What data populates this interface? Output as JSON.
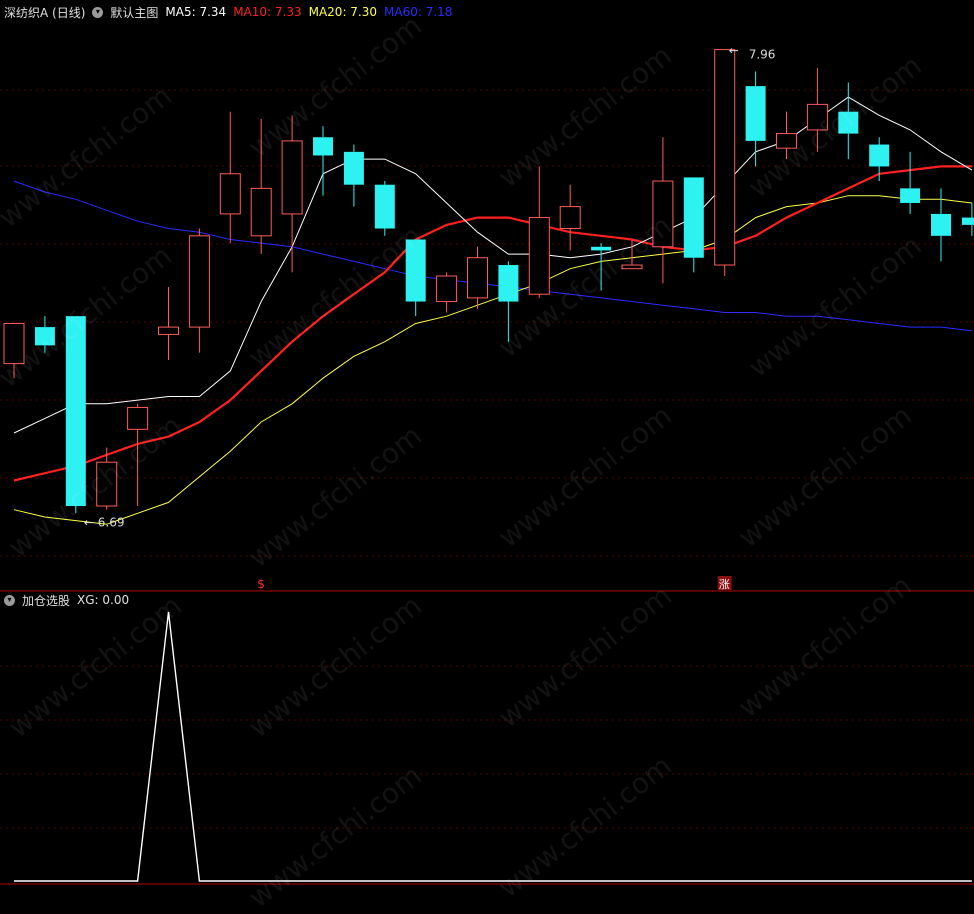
{
  "main_header": {
    "stock_title": "深纺织A (日线)",
    "template_name": "默认主图",
    "ma5": "MA5: 7.34",
    "ma10": "MA10: 7.33",
    "ma20": "MA20: 7.30",
    "ma60": "MA60: 7.18"
  },
  "sub_header": {
    "indicator_name": "加仓选股",
    "xg": "XG: 0.00"
  },
  "watermark": "www.cfchi.com",
  "colors": {
    "background": "#000000",
    "up": "#ff5b5b",
    "down": "#2ef2f2",
    "ma5": "#ffffff",
    "ma10": "#ff2020",
    "ma20": "#ffff4a",
    "ma60": "#2b2bff",
    "grid": "#5a0000",
    "divider": "#b00000"
  },
  "chart_data": [
    {
      "type": "candlestick",
      "title": "深纺织A (日线)",
      "ylim": [
        6.48,
        8.02
      ],
      "grid": true,
      "high_label": "7.96",
      "low_label": "6.69",
      "markers": [
        "$",
        "涨"
      ],
      "candles": [
        {
          "o": 7.1,
          "c": 7.21,
          "h": 7.21,
          "l": 7.06
        },
        {
          "o": 7.2,
          "c": 7.15,
          "h": 7.23,
          "l": 7.13
        },
        {
          "o": 7.23,
          "c": 6.71,
          "h": 7.23,
          "l": 6.69
        },
        {
          "o": 6.71,
          "c": 6.83,
          "h": 6.87,
          "l": 6.7
        },
        {
          "o": 6.92,
          "c": 6.98,
          "h": 6.99,
          "l": 6.71
        },
        {
          "o": 7.18,
          "c": 7.2,
          "h": 7.31,
          "l": 7.11
        },
        {
          "o": 7.2,
          "c": 7.45,
          "h": 7.47,
          "l": 7.13
        },
        {
          "o": 7.51,
          "c": 7.62,
          "h": 7.79,
          "l": 7.43
        },
        {
          "o": 7.45,
          "c": 7.58,
          "h": 7.77,
          "l": 7.4
        },
        {
          "o": 7.51,
          "c": 7.71,
          "h": 7.78,
          "l": 7.35
        },
        {
          "o": 7.72,
          "c": 7.67,
          "h": 7.75,
          "l": 7.56
        },
        {
          "o": 7.68,
          "c": 7.59,
          "h": 7.7,
          "l": 7.53
        },
        {
          "o": 7.59,
          "c": 7.47,
          "h": 7.6,
          "l": 7.45
        },
        {
          "o": 7.44,
          "c": 7.27,
          "h": 7.44,
          "l": 7.23
        },
        {
          "o": 7.27,
          "c": 7.34,
          "h": 7.35,
          "l": 7.24
        },
        {
          "o": 7.28,
          "c": 7.39,
          "h": 7.42,
          "l": 7.25
        },
        {
          "o": 7.37,
          "c": 7.27,
          "h": 7.38,
          "l": 7.16
        },
        {
          "o": 7.29,
          "c": 7.5,
          "h": 7.64,
          "l": 7.28
        },
        {
          "o": 7.47,
          "c": 7.53,
          "h": 7.59,
          "l": 7.41
        },
        {
          "o": 7.42,
          "c": 7.41,
          "h": 7.43,
          "l": 7.3
        },
        {
          "o": 7.36,
          "c": 7.37,
          "h": 7.44,
          "l": 7.36
        },
        {
          "o": 7.42,
          "c": 7.6,
          "h": 7.72,
          "l": 7.32
        },
        {
          "o": 7.61,
          "c": 7.39,
          "h": 7.61,
          "l": 7.35
        },
        {
          "o": 7.37,
          "c": 7.96,
          "h": 7.96,
          "l": 7.34
        },
        {
          "o": 7.86,
          "c": 7.71,
          "h": 7.9,
          "l": 7.64
        },
        {
          "o": 7.69,
          "c": 7.73,
          "h": 7.79,
          "l": 7.66
        },
        {
          "o": 7.74,
          "c": 7.81,
          "h": 7.91,
          "l": 7.68
        },
        {
          "o": 7.79,
          "c": 7.73,
          "h": 7.87,
          "l": 7.66
        },
        {
          "o": 7.7,
          "c": 7.64,
          "h": 7.72,
          "l": 7.6
        },
        {
          "o": 7.58,
          "c": 7.54,
          "h": 7.68,
          "l": 7.51
        },
        {
          "o": 7.51,
          "c": 7.45,
          "h": 7.58,
          "l": 7.38
        },
        {
          "o": 7.5,
          "c": 7.48,
          "h": 7.54,
          "l": 7.45
        }
      ],
      "series": [
        {
          "name": "MA5",
          "values": [
            6.91,
            6.95,
            6.99,
            6.99,
            7.0,
            7.01,
            7.01,
            7.08,
            7.27,
            7.42,
            7.62,
            7.66,
            7.66,
            7.62,
            7.54,
            7.46,
            7.4,
            7.4,
            7.39,
            7.4,
            7.42,
            7.46,
            7.5,
            7.59,
            7.68,
            7.71,
            7.77,
            7.83,
            7.78,
            7.74,
            7.68,
            7.63
          ]
        },
        {
          "name": "MA10",
          "values": [
            6.78,
            6.8,
            6.82,
            6.85,
            6.88,
            6.9,
            6.94,
            7.0,
            7.08,
            7.16,
            7.23,
            7.29,
            7.35,
            7.44,
            7.48,
            7.5,
            7.5,
            7.48,
            7.46,
            7.45,
            7.44,
            7.42,
            7.41,
            7.42,
            7.45,
            7.5,
            7.54,
            7.58,
            7.62,
            7.63,
            7.64,
            7.64
          ]
        },
        {
          "name": "MA20",
          "values": [
            6.7,
            6.68,
            6.67,
            6.66,
            6.69,
            6.72,
            6.79,
            6.86,
            6.94,
            6.99,
            7.06,
            7.12,
            7.16,
            7.21,
            7.23,
            7.26,
            7.29,
            7.32,
            7.36,
            7.38,
            7.39,
            7.4,
            7.41,
            7.44,
            7.5,
            7.53,
            7.54,
            7.56,
            7.56,
            7.55,
            7.55,
            7.54
          ]
        },
        {
          "name": "MA60",
          "values": [
            7.6,
            7.57,
            7.55,
            7.52,
            7.49,
            7.47,
            7.46,
            7.44,
            7.43,
            7.42,
            7.4,
            7.38,
            7.36,
            7.34,
            7.33,
            7.32,
            7.31,
            7.3,
            7.29,
            7.28,
            7.27,
            7.26,
            7.25,
            7.24,
            7.24,
            7.23,
            7.23,
            7.22,
            7.21,
            7.2,
            7.2,
            7.19
          ]
        }
      ]
    },
    {
      "type": "line",
      "title": "加仓选股",
      "ylim": [
        0,
        1
      ],
      "series": [
        {
          "name": "XG",
          "values": [
            0,
            0,
            0,
            0,
            0,
            1,
            0,
            0,
            0,
            0,
            0,
            0,
            0,
            0,
            0,
            0,
            0,
            0,
            0,
            0,
            0,
            0,
            0,
            0,
            0,
            0,
            0,
            0,
            0,
            0,
            0,
            0
          ]
        }
      ]
    }
  ]
}
